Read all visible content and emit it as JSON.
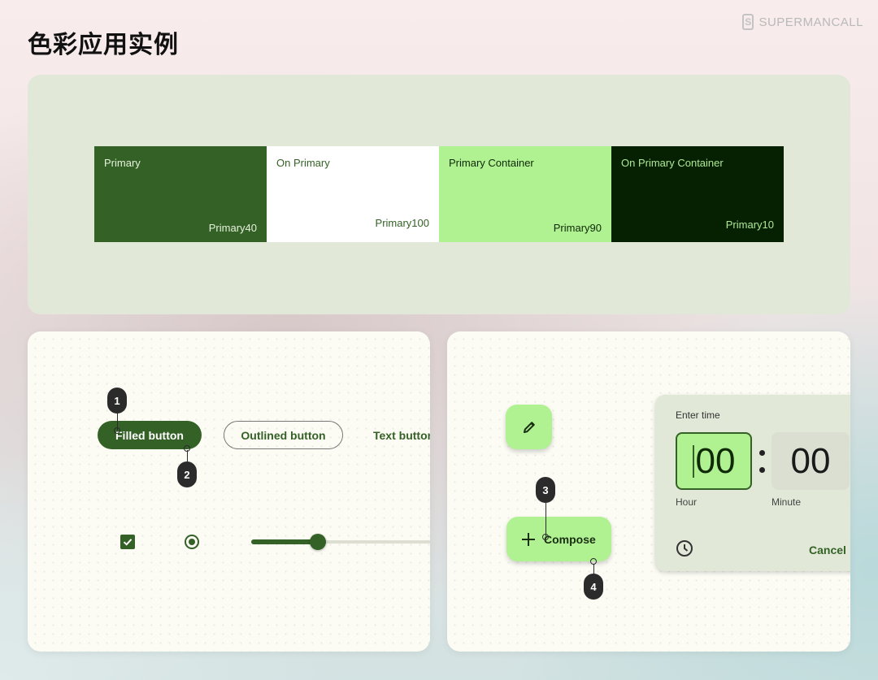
{
  "header": {
    "title": "色彩应用实例",
    "brand": {
      "icon": "supermancall-logo-icon",
      "logo_glyph": "S",
      "name": "SUPERMANCALL"
    }
  },
  "palette": {
    "swatches": [
      {
        "role": "Primary",
        "tone": "Primary40",
        "color": "#346126",
        "text_color": "#e6f1dc"
      },
      {
        "role": "On Primary",
        "tone": "Primary100",
        "color": "#ffffff",
        "text_color": "#346126"
      },
      {
        "role": "Primary Container",
        "tone": "Primary90",
        "color": "#b0f192",
        "text_color": "#0f2a06"
      },
      {
        "role": "On Primary Container",
        "tone": "Primary10",
        "color": "#062102",
        "text_color": "#aee895"
      }
    ]
  },
  "components": {
    "buttons": {
      "filled": "Filled button",
      "outlined": "Outlined button",
      "text": "Text button"
    },
    "checkbox": {
      "checked": true
    },
    "radio": {
      "selected": true
    },
    "slider": {
      "value_fraction": 0.34
    },
    "callouts": [
      "1",
      "2",
      "3",
      "4"
    ]
  },
  "fab": {
    "icon": "pencil-icon",
    "extended_label": "Compose",
    "extended_icon": "plus-icon"
  },
  "time_picker": {
    "title": "Enter time",
    "hour_value": "00",
    "minute_value": "00",
    "hour_label": "Hour",
    "minute_label": "Minute",
    "mode_icon": "clock-icon",
    "cancel_label": "Cancel"
  },
  "colors": {
    "primary": "#346126",
    "primary_container": "#b0f192",
    "on_primary_container": "#062102",
    "surface": "#e1e8d8"
  }
}
